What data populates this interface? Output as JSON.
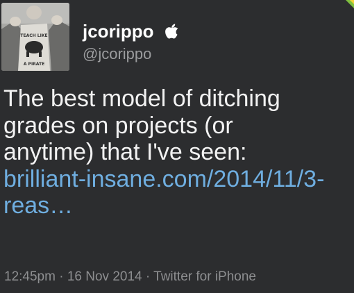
{
  "user": {
    "display_name": "jcorippo",
    "handle": "@jcorippo",
    "verified_icon": "apple-icon",
    "avatar_shirt_text_top": "TEACH LIKE",
    "avatar_shirt_text_bottom": "A PIRATE"
  },
  "tweet": {
    "lines": [
      "The best model of ditching",
      "grades on projects (or",
      "anytime) that I've seen:"
    ],
    "link_lines": [
      "brilliant-insane.com/2014/11/3-",
      "reas…"
    ]
  },
  "meta": {
    "time": "12:45pm",
    "separator": " · ",
    "date": "16 Nov 2014",
    "source": "Twitter for iPhone"
  },
  "colors": {
    "background": "#2c2d2f",
    "text": "#f2f2f2",
    "link": "#6faee0",
    "muted": "#8e8f91"
  }
}
